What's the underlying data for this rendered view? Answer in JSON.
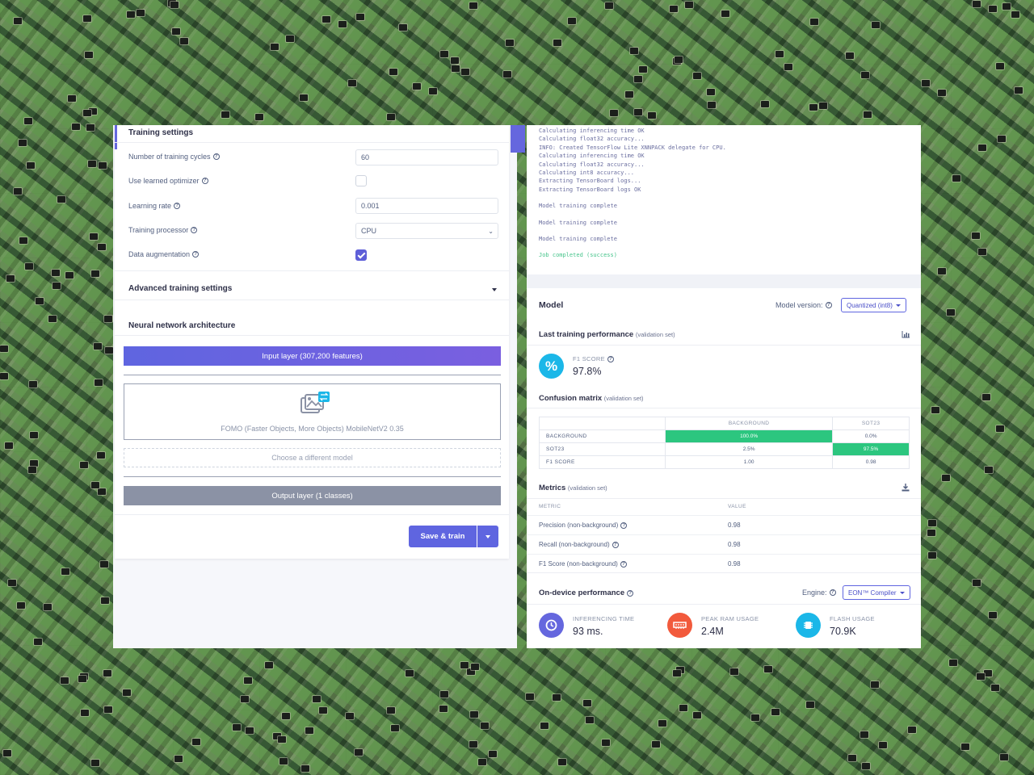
{
  "training_settings": {
    "title": "Training settings",
    "cycles_label": "Number of training cycles",
    "cycles_value": "60",
    "learned_optimizer_label": "Use learned optimizer",
    "learned_optimizer_checked": false,
    "learning_rate_label": "Learning rate",
    "learning_rate_value": "0.001",
    "processor_label": "Training processor",
    "processor_value": "CPU",
    "augmentation_label": "Data augmentation",
    "augmentation_checked": true,
    "advanced_label": "Advanced training settings"
  },
  "architecture": {
    "title": "Neural network architecture",
    "input_layer": "Input layer (307,200 features)",
    "model_name": "FOMO (Faster Objects, More Objects) MobileNetV2 0.35",
    "choose_model": "Choose a different model",
    "output_layer": "Output layer (1 classes)",
    "save_button": "Save & train"
  },
  "log": {
    "lines": [
      "Calculating inferencing time OK",
      "Calculating float32 accuracy...",
      "INFO: Created TensorFlow Lite XNNPACK delegate for CPU.",
      "Calculating inferencing time OK",
      "Calculating float32 accuracy...",
      "Calculating int8 accuracy...",
      "Extracting TensorBoard logs...",
      "Extracting TensorBoard logs OK"
    ],
    "complete_1": "Model training complete",
    "complete_2": "Model training complete",
    "complete_3": "Model training complete",
    "success": "Job completed (success)"
  },
  "model": {
    "title": "Model",
    "version_label": "Model version:",
    "version_value": "Quantized (int8)",
    "last_perf_title": "Last training performance",
    "last_perf_sub": "(validation set)",
    "f1_label": "F1 SCORE",
    "f1_value": "97.8%",
    "confusion_title": "Confusion matrix",
    "confusion_sub": "(validation set)",
    "confusion": {
      "columns": [
        "BACKGROUND",
        "SOT23"
      ],
      "rows": [
        {
          "label": "BACKGROUND",
          "values": [
            "100.0%",
            "0.0%"
          ],
          "highlight": [
            true,
            false
          ]
        },
        {
          "label": "SOT23",
          "values": [
            "2.5%",
            "97.5%"
          ],
          "highlight": [
            false,
            true
          ]
        },
        {
          "label": "F1 SCORE",
          "values": [
            "1.00",
            "0.98"
          ],
          "highlight": [
            false,
            false
          ]
        }
      ]
    },
    "metrics_title": "Metrics",
    "metrics_sub": "(validation set)",
    "metrics_col_metric": "METRIC",
    "metrics_col_value": "VALUE",
    "metrics": [
      {
        "name": "Precision (non-background)",
        "value": "0.98"
      },
      {
        "name": "Recall (non-background)",
        "value": "0.98"
      },
      {
        "name": "F1 Score (non-background)",
        "value": "0.98"
      }
    ],
    "ondevice_title": "On-device performance",
    "engine_label": "Engine:",
    "engine_value": "EON™ Compiler",
    "inferencing_label": "INFERENCING TIME",
    "inferencing_value": "93 ms.",
    "ram_label": "PEAK RAM USAGE",
    "ram_value": "2.4M",
    "flash_label": "FLASH USAGE",
    "flash_value": "70.9K"
  },
  "colors": {
    "accent": "#5f65e0",
    "success": "#2cc67f",
    "clock_icon": "#6567de",
    "ram_icon": "#f25a3c",
    "flash_icon": "#1bb7e8"
  }
}
